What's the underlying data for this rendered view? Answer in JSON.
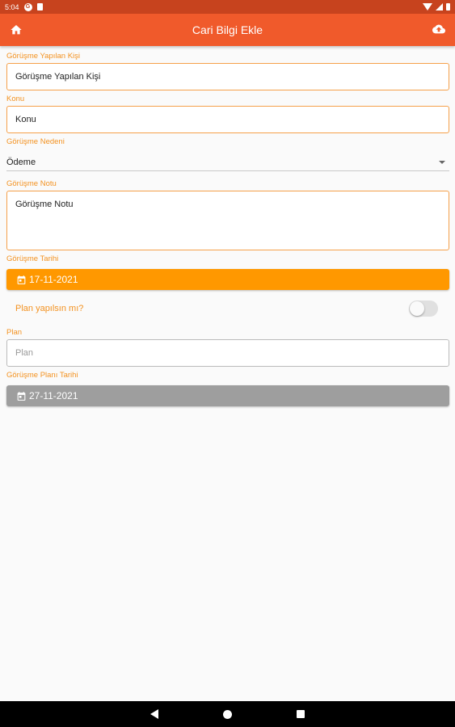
{
  "status_bar": {
    "time": "5:04"
  },
  "app_bar": {
    "title": "Cari Bilgi Ekle",
    "home_icon": "home-icon",
    "upload_icon": "cloud-upload-icon"
  },
  "form": {
    "gorusme_yapilan_kisi": {
      "label": "Görüşme Yapılan Kişi",
      "placeholder": "Görüşme Yapılan Kişi"
    },
    "konu": {
      "label": "Konu",
      "placeholder": "Konu"
    },
    "gorusme_nedeni": {
      "label": "Görüşme Nedeni",
      "selected": "Ödeme"
    },
    "gorusme_notu": {
      "label": "Görüşme Notu",
      "placeholder": "Görüşme Notu"
    },
    "gorusme_tarihi": {
      "label": "Görüşme Tarihi",
      "value": "17-11-2021"
    },
    "plan_toggle": {
      "label": "Plan yapılsın mı?",
      "on": false
    },
    "plan": {
      "label": "Plan",
      "placeholder": "Plan"
    },
    "gorusme_plan_tarihi": {
      "label": "Görüşme Planı Tarihi",
      "value": "27-11-2021"
    }
  },
  "colors": {
    "status_bar": "#c7431e",
    "app_bar": "#f05a2b",
    "accent": "#ff9800",
    "label": "#f39221",
    "disabled": "#9e9e9e"
  }
}
